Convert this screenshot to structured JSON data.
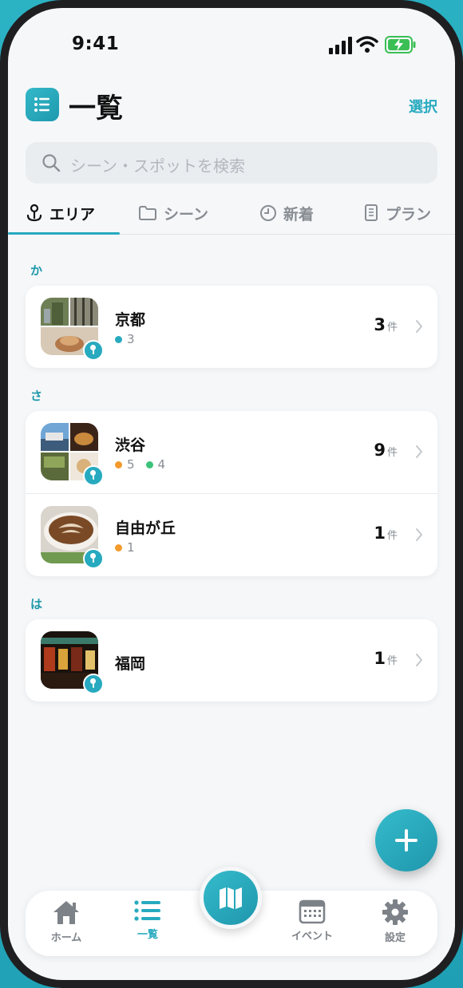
{
  "status": {
    "time": "9:41"
  },
  "header": {
    "title": "一覧",
    "select_label": "選択",
    "app_icon": "list-icon"
  },
  "search": {
    "placeholder": "シーン・スポットを検索"
  },
  "tabs": [
    {
      "label": "エリア",
      "icon": "anchor-pin-icon",
      "active": true
    },
    {
      "label": "シーン",
      "icon": "folder-icon",
      "active": false
    },
    {
      "label": "新着",
      "icon": "clock-icon",
      "active": false
    },
    {
      "label": "プラン",
      "icon": "document-icon",
      "active": false
    }
  ],
  "sections": [
    {
      "label": "か",
      "rows": [
        {
          "name": "京都",
          "dots": [
            {
              "color": "#27aabf",
              "count": "3"
            }
          ],
          "count": "3",
          "unit": "件"
        }
      ]
    },
    {
      "label": "さ",
      "rows": [
        {
          "name": "渋谷",
          "dots": [
            {
              "color": "#f39a2b",
              "count": "5"
            },
            {
              "color": "#3cc27a",
              "count": "4"
            }
          ],
          "count": "9",
          "unit": "件"
        },
        {
          "name": "自由が丘",
          "dots": [
            {
              "color": "#f39a2b",
              "count": "1"
            }
          ],
          "count": "1",
          "unit": "件"
        }
      ]
    },
    {
      "label": "は",
      "rows": [
        {
          "name": "福岡",
          "dots": [],
          "count": "1",
          "unit": "件"
        }
      ]
    }
  ],
  "tabbar": [
    {
      "label": "ホーム",
      "icon": "home-icon",
      "active": false
    },
    {
      "label": "一覧",
      "icon": "list-icon",
      "active": true
    },
    {
      "label": "イベント",
      "icon": "calendar-icon",
      "active": false
    },
    {
      "label": "設定",
      "icon": "gear-icon",
      "active": false
    }
  ],
  "colors": {
    "accent": "#27aabf",
    "background": "#f5f7f9"
  }
}
